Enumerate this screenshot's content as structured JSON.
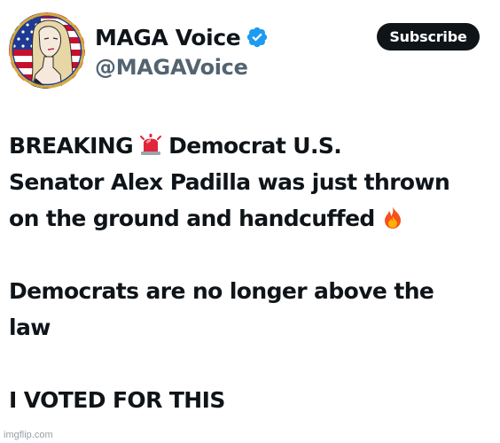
{
  "account": {
    "display_name": "MAGA Voice",
    "handle": "@MAGAVoice",
    "verified_icon": "verified-badge-icon",
    "avatar": "profile-avatar"
  },
  "actions": {
    "subscribe_label": "Subscribe"
  },
  "tweet": {
    "line1_a": "BREAKING",
    "line1_emoji": "police-siren-emoji",
    "line1_b": "Democrat U.S.",
    "line2": "Senator Alex Padilla was just thrown",
    "line3_a": "on the ground and handcuffed",
    "line3_emoji": "fire-emoji",
    "line4": "Democrats are no longer above the",
    "line5": "law",
    "line6": "I VOTED FOR THIS"
  },
  "watermark": "imgflip.com",
  "colors": {
    "text": "#0f1419",
    "handle": "#536471",
    "verified": "#1d9bf0",
    "button_bg": "#0f1419",
    "button_text": "#ffffff"
  }
}
